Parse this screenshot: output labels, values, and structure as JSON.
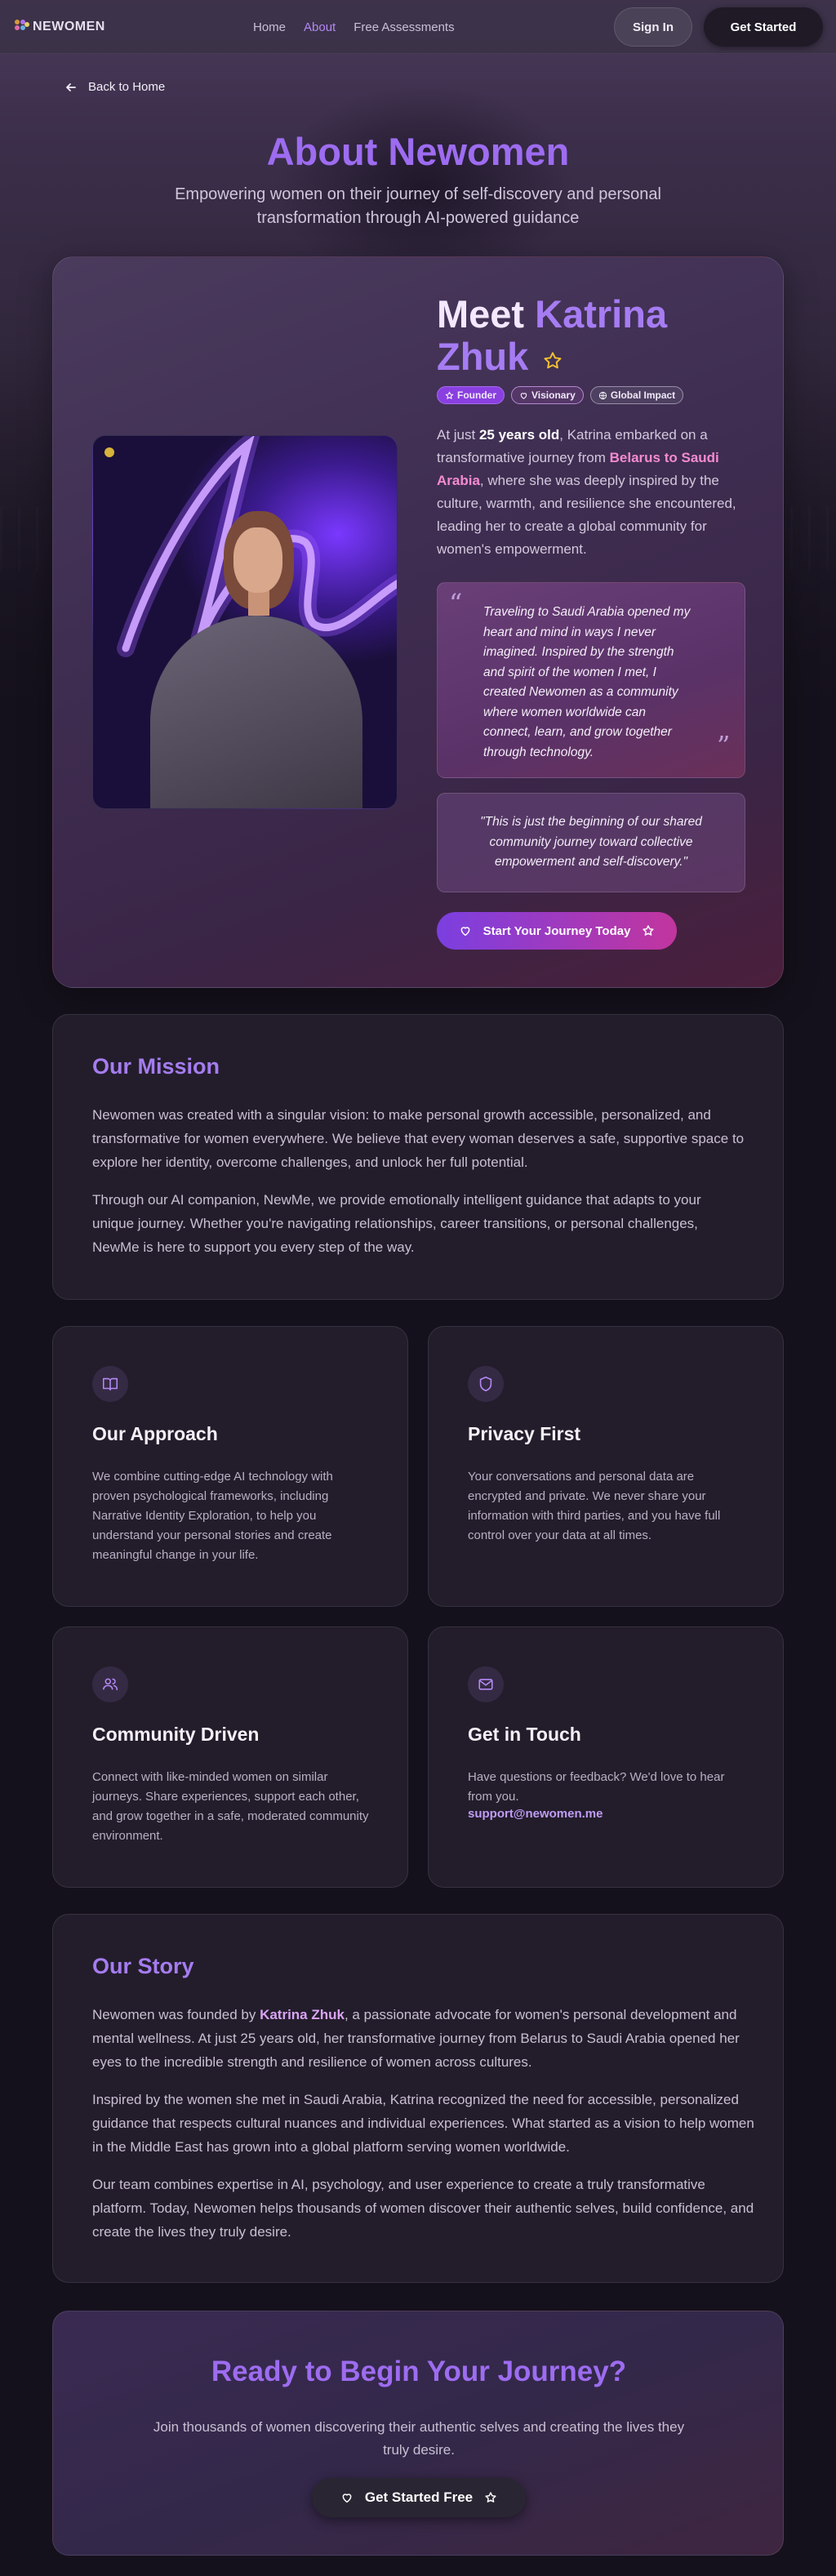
{
  "nav": {
    "logo": "NEWOMEN",
    "links": [
      "Home",
      "About",
      "Free Assessments"
    ],
    "sign_in": "Sign In",
    "get_started": "Get Started"
  },
  "back": "Back to Home",
  "hero": {
    "title": "About Newomen",
    "subtitle": "Empowering women on their journey of self-discovery and personal transformation through AI-powered guidance"
  },
  "founder": {
    "meet": "Meet",
    "name": "Katrina Zhuk",
    "badges": [
      "Founder",
      "Visionary",
      "Global Impact"
    ],
    "intro_1": "At just ",
    "intro_age": "25 years old",
    "intro_2": ", Katrina embarked on a transformative journey from ",
    "intro_route": "Belarus to Saudi Arabia",
    "intro_3": ", where she was deeply inspired by the culture, warmth, and resilience she encountered, leading her to create a global community for women's empowerment.",
    "quote": "Traveling to Saudi Arabia opened my heart and mind in ways I never imagined. Inspired by the strength and spirit of the women I met, I created Newomen as a community where women worldwide can connect, learn, and grow together through technology.",
    "quote2": "\"This is just the beginning of our shared community journey toward collective empowerment and self-discovery.\"",
    "cta": "Start Your Journey Today"
  },
  "mission": {
    "title": "Our Mission",
    "p1": "Newomen was created with a singular vision: to make personal growth accessible, personalized, and transformative for women everywhere. We believe that every woman deserves a safe, supportive space to explore her identity, overcome challenges, and unlock her full potential.",
    "p2": "Through our AI companion, NewMe, we provide emotionally intelligent guidance that adapts to your unique journey. Whether you're navigating relationships, career transitions, or personal challenges, NewMe is here to support you every step of the way."
  },
  "features": [
    {
      "title": "Our Approach",
      "text": "We combine cutting-edge AI technology with proven psychological frameworks, including Narrative Identity Exploration, to help you understand your personal stories and create meaningful change in your life.",
      "icon": "book-icon"
    },
    {
      "title": "Privacy First",
      "text": "Your conversations and personal data are encrypted and private. We never share your information with third parties, and you have full control over your data at all times.",
      "icon": "shield-icon"
    },
    {
      "title": "Community Driven",
      "text": "Connect with like-minded women on similar journeys. Share experiences, support each other, and grow together in a safe, moderated community environment.",
      "icon": "users-icon"
    },
    {
      "title": "Get in Touch",
      "text": "Have questions or feedback? We'd love to hear from you.",
      "icon": "mail-icon",
      "email": "support@newomen.me"
    }
  ],
  "story": {
    "title": "Our Story",
    "p1_a": "Newomen was founded by ",
    "p1_name": "Katrina Zhuk",
    "p1_b": ", a passionate advocate for women's personal development and mental wellness. At just 25 years old, her transformative journey from Belarus to Saudi Arabia opened her eyes to the incredible strength and resilience of women across cultures.",
    "p2": "Inspired by the women she met in Saudi Arabia, Katrina recognized the need for accessible, personalized guidance that respects cultural nuances and individual experiences. What started as a vision to help women in the Middle East has grown into a global platform serving women worldwide.",
    "p3": "Our team combines expertise in AI, psychology, and user experience to create a truly transformative platform. Today, Newomen helps thousands of women discover their authentic selves, build confidence, and create the lives they truly desire."
  },
  "cta": {
    "title": "Ready to Begin Your Journey?",
    "subtitle": "Join thousands of women discovering their authentic selves and creating the lives they truly desire.",
    "button": "Get Started Free"
  },
  "colors": {
    "accent": "#9d6cf0",
    "pink": "#f48bd0",
    "background": "#15111c"
  }
}
